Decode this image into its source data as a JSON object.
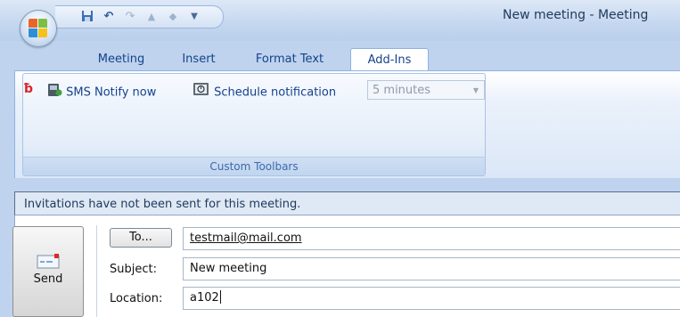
{
  "window": {
    "title": "New meeting - Meeting"
  },
  "quick_access": {
    "icons": [
      "save-icon",
      "undo-icon",
      "redo-icon",
      "previous-item-icon",
      "next-item-icon",
      "customize-dropdown-icon"
    ]
  },
  "tabs": [
    {
      "label": "Meeting",
      "active": false
    },
    {
      "label": "Insert",
      "active": false
    },
    {
      "label": "Format Text",
      "active": false
    },
    {
      "label": "Add-Ins",
      "active": true
    }
  ],
  "ribbon": {
    "group_label": "Custom Toolbars",
    "sms_notify_label": "SMS Notify now",
    "schedule_label": "Schedule notification",
    "interval_value": "5 minutes"
  },
  "infobar": {
    "text": "Invitations have not been sent for this meeting."
  },
  "form": {
    "send_label": "Send",
    "to_label": "To...",
    "to_value": "testmail@mail.com",
    "subject_label": "Subject:",
    "subject_value": "New meeting",
    "location_label": "Location:",
    "location_value": "a102"
  },
  "colors": {
    "accent": "#15428b",
    "ribbon_border": "#8db2e3",
    "background": "#bfd3ee"
  }
}
